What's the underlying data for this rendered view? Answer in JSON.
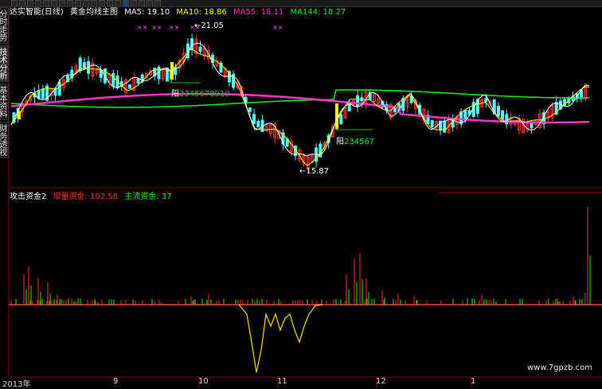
{
  "toolbar": {
    "buttons": [
      "",
      "",
      "",
      "",
      "",
      "",
      "",
      "",
      "",
      "",
      "",
      "",
      "",
      "",
      "",
      "",
      "",
      "",
      ""
    ],
    "active_index": 14
  },
  "sidebar": {
    "tabs": [
      {
        "label": "分时走势"
      },
      {
        "label": "技术分析"
      },
      {
        "label": "基本资料"
      },
      {
        "label": "财务透视"
      }
    ],
    "active_index": 1
  },
  "main": {
    "stock": "达实智能(日线)",
    "indicator": "黄金均线主图",
    "ma": [
      {
        "label": "MA5: 19.10",
        "color": "#ffffff"
      },
      {
        "label": "MA10: 18.86",
        "color": "#ffff00"
      },
      {
        "label": "MA55: 18.11",
        "color": "#ff33cc"
      },
      {
        "label": "MA144: 18.27",
        "color": "#00ff00"
      }
    ],
    "high_label": "21.05",
    "low_label": "15.87",
    "yang1_label": "阳",
    "yang1_value": "2345678910",
    "yang2_label": "阳",
    "yang2_value": "234567"
  },
  "sub": {
    "name": "攻击资金2",
    "items": [
      {
        "label": "增量资金: 102.58",
        "color": "#ff3333"
      },
      {
        "label": "主流资金: 37",
        "color": "#00ff00"
      }
    ]
  },
  "dates": [
    "2013年",
    "9",
    "10",
    "11",
    "12",
    "1"
  ],
  "watermark": "www.7gpzb.com",
  "colors": {
    "up": "#ff3232",
    "down": "#54ffff",
    "yang_bar": "#ffff00"
  }
}
